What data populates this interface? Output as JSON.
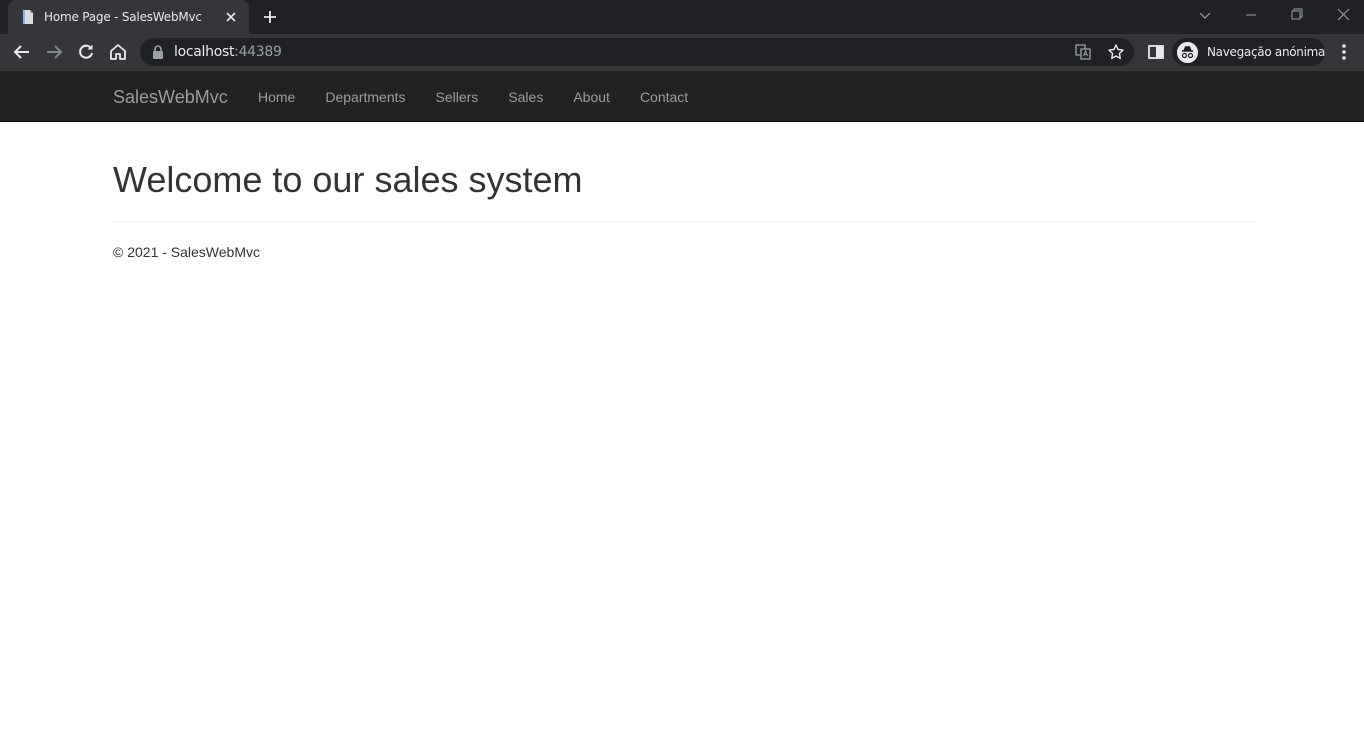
{
  "browser": {
    "tab": {
      "title": "Home Page - SalesWebMvc"
    },
    "address": {
      "host": "localhost",
      "port": ":44389"
    },
    "profile": {
      "label": "Navegação anónima"
    },
    "colors": {
      "frame": "#202124",
      "toolbar": "#35363a",
      "text": "#e8eaed"
    }
  },
  "navbar": {
    "brand": "SalesWebMvc",
    "links": [
      "Home",
      "Departments",
      "Sellers",
      "Sales",
      "About",
      "Contact"
    ]
  },
  "main": {
    "heading": "Welcome to our sales system"
  },
  "footer": {
    "text": "© 2021 - SalesWebMvc"
  },
  "colors": {
    "navbar_bg": "#222222",
    "nav_text": "#9d9d9d",
    "body_text": "#333333"
  }
}
